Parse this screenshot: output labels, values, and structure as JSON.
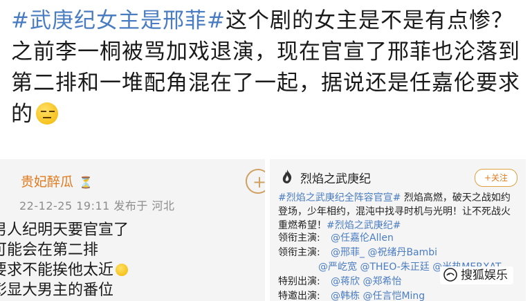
{
  "post": {
    "hashtag": "#武庚纪女主是邢菲#",
    "body": "这个剧的女主是不是有点惨？之前李一桐被骂加戏退演，现在官宣了邢菲也沦落到第二排和一堆配角混在了一起，据说还是任嘉伦要求的"
  },
  "left_card": {
    "username": "贵妃醉瓜",
    "badge": "⏳",
    "meta": "22-12-25 19:11  发布于 河北",
    "follow_symbol": "+",
    "lines": [
      "男人纪明天要官宣了",
      "可能会在第二排",
      "要求不能挨他太近",
      "彰显大男主的番位"
    ]
  },
  "right_card": {
    "account_name": "烈焰之武庚纪",
    "follow_label": "+关注",
    "tag": "#烈焰之武庚纪全阵容官宣#",
    "text": " 烈焰高燃，破天之战如约登场，少年相约，混沌中找寻时机与光明！让不死战火重燃希望！",
    "tag2": "#烈焰之武庚纪#",
    "cast": [
      {
        "role": "领衔主演:",
        "names": "@任嘉伦Allen"
      },
      {
        "role": "领衔主演:",
        "names": "@邢菲_ @祝绪丹Bambi"
      },
      {
        "role": "",
        "names": "@严屹宽 @THEO-朱正廷 @米热MERXAT"
      },
      {
        "role": "特别出演:",
        "names": "@蒋欣 @郑希怡"
      },
      {
        "role": "特邀出演:",
        "names": "@韩栋 @任言恺Ming"
      }
    ]
  },
  "watermark": {
    "text": "搜狐娱乐"
  }
}
